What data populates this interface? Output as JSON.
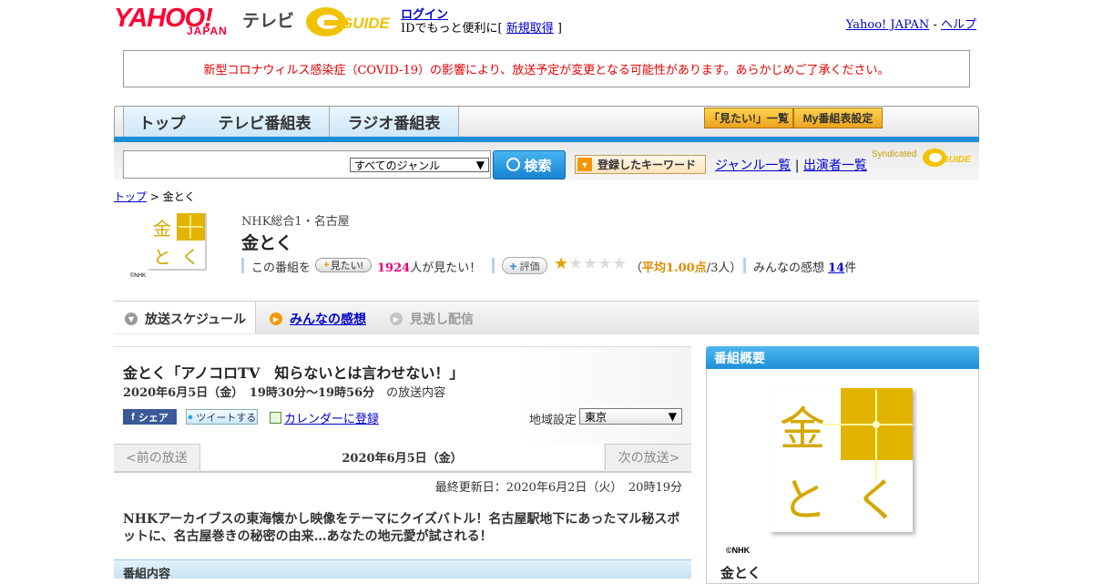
{
  "header": {
    "yahoo": "YAHOO!",
    "japan": "JAPAN",
    "tv": "テレビ",
    "gguide": "GUIDE",
    "login": "ログイン",
    "login_sub_prefix": "IDでもっと便利に[ ",
    "signup": "新規取得",
    "login_sub_suffix": " ]",
    "yahoo_japan_link": "Yahoo! JAPAN",
    "separator": " - ",
    "help_link": "ヘルプ"
  },
  "notice": "新型コロナウィルス感染症（COVID-19）の影響により、放送予定が変更となる可能性があります。あらかじめご了承ください。",
  "nav": {
    "tabs": [
      "トップ",
      "テレビ番組表",
      "ラジオ番組表"
    ],
    "mitai_list": "「見たい!」一覧",
    "my_settings": "My番組表設定"
  },
  "search": {
    "genre": "すべてのジャンル",
    "button": "検索",
    "keyword_button": "登録したキーワード",
    "genre_list": "ジャンル一覧",
    "sep": "|",
    "performers": "出演者一覧",
    "syndicated": "Syndicated"
  },
  "breadcrumb": {
    "top": "トップ",
    "sep": " > ",
    "current": "金とく"
  },
  "program": {
    "channel": "NHK総合1・名古屋",
    "title": "金とく",
    "logo_char1": "金",
    "logo_char2": "と",
    "logo_char3": "く",
    "credit": "©NHK",
    "want_prefix": "この番組を",
    "want_button": "見たい!",
    "want_count": "1924",
    "want_suffix": "人が見たい！",
    "rate_button": "評価",
    "rating_value": 1,
    "rating_max": 5,
    "rating_open": "（",
    "rating_avg": "平均1.00点",
    "rating_count": "/3人）",
    "impressions_prefix": "みんなの感想 ",
    "impressions_count": "14",
    "impressions_suffix": "件",
    "brand_color": "#e2b400"
  },
  "subtabs": [
    "放送スケジュール",
    "みんなの感想",
    "見逃し配信"
  ],
  "episode": {
    "title": "金とく「アノコロTV　知らないとは言わせない！」",
    "datetime": "2020年6月5日（金）　19時30分～19時56分",
    "datetime_suffix": "　の放送内容",
    "share": "シェア",
    "tweet": "ツイートする",
    "calendar": "カレンダーに登録",
    "region_label": "地域設定",
    "region_value": "東京",
    "prev": "<前の放送",
    "current_date": "2020年6月5日（金）",
    "next": "次の放送>",
    "updated": "最終更新日：2020年6月2日（火）　20時19分",
    "description": "NHKアーカイブスの東海懐かし映像をテーマにクイズバトル！名古屋駅地下にあったマル秘スポットに、名古屋巻きの秘密の由来…あなたの地元愛が試される！",
    "section_title": "番組内容"
  },
  "sidebar": {
    "header": "番組概要",
    "credit": "©NHK",
    "name": "金とく"
  }
}
